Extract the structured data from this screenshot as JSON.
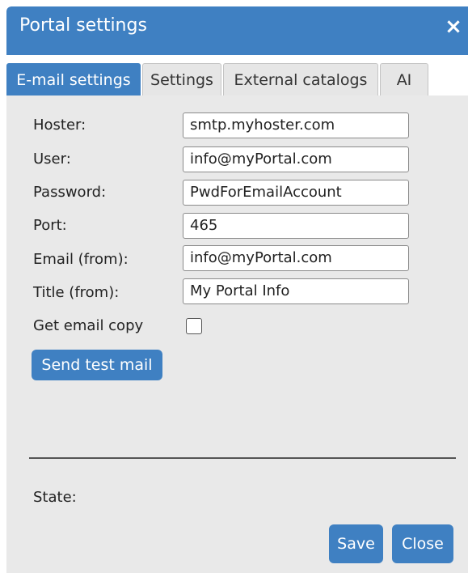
{
  "dialog": {
    "title": "Portal settings",
    "close_icon": "×"
  },
  "tabs": [
    {
      "label": "E-mail settings",
      "active": true
    },
    {
      "label": "Settings",
      "active": false
    },
    {
      "label": "External catalogs",
      "active": false
    },
    {
      "label": "AI",
      "active": false
    }
  ],
  "form": {
    "hoster": {
      "label": "Hoster:",
      "value": "smtp.myhoster.com"
    },
    "user": {
      "label": "User:",
      "value": "info@myPortal.com"
    },
    "password": {
      "label": "Password:",
      "value": "PwdForEmailAccount"
    },
    "port": {
      "label": "Port:",
      "value": "465"
    },
    "email_from": {
      "label": "Email (from):",
      "value": "info@myPortal.com"
    },
    "title_from": {
      "label": "Title (from):",
      "value": "My Portal Info"
    },
    "get_email_copy": {
      "label": "Get email copy",
      "checked": false
    }
  },
  "buttons": {
    "send_test_mail": "Send test mail",
    "save": "Save",
    "close": "Close"
  },
  "status": {
    "state_label": "State:"
  },
  "colors": {
    "accent": "#3f80c2",
    "panel": "#e9e9e9"
  }
}
